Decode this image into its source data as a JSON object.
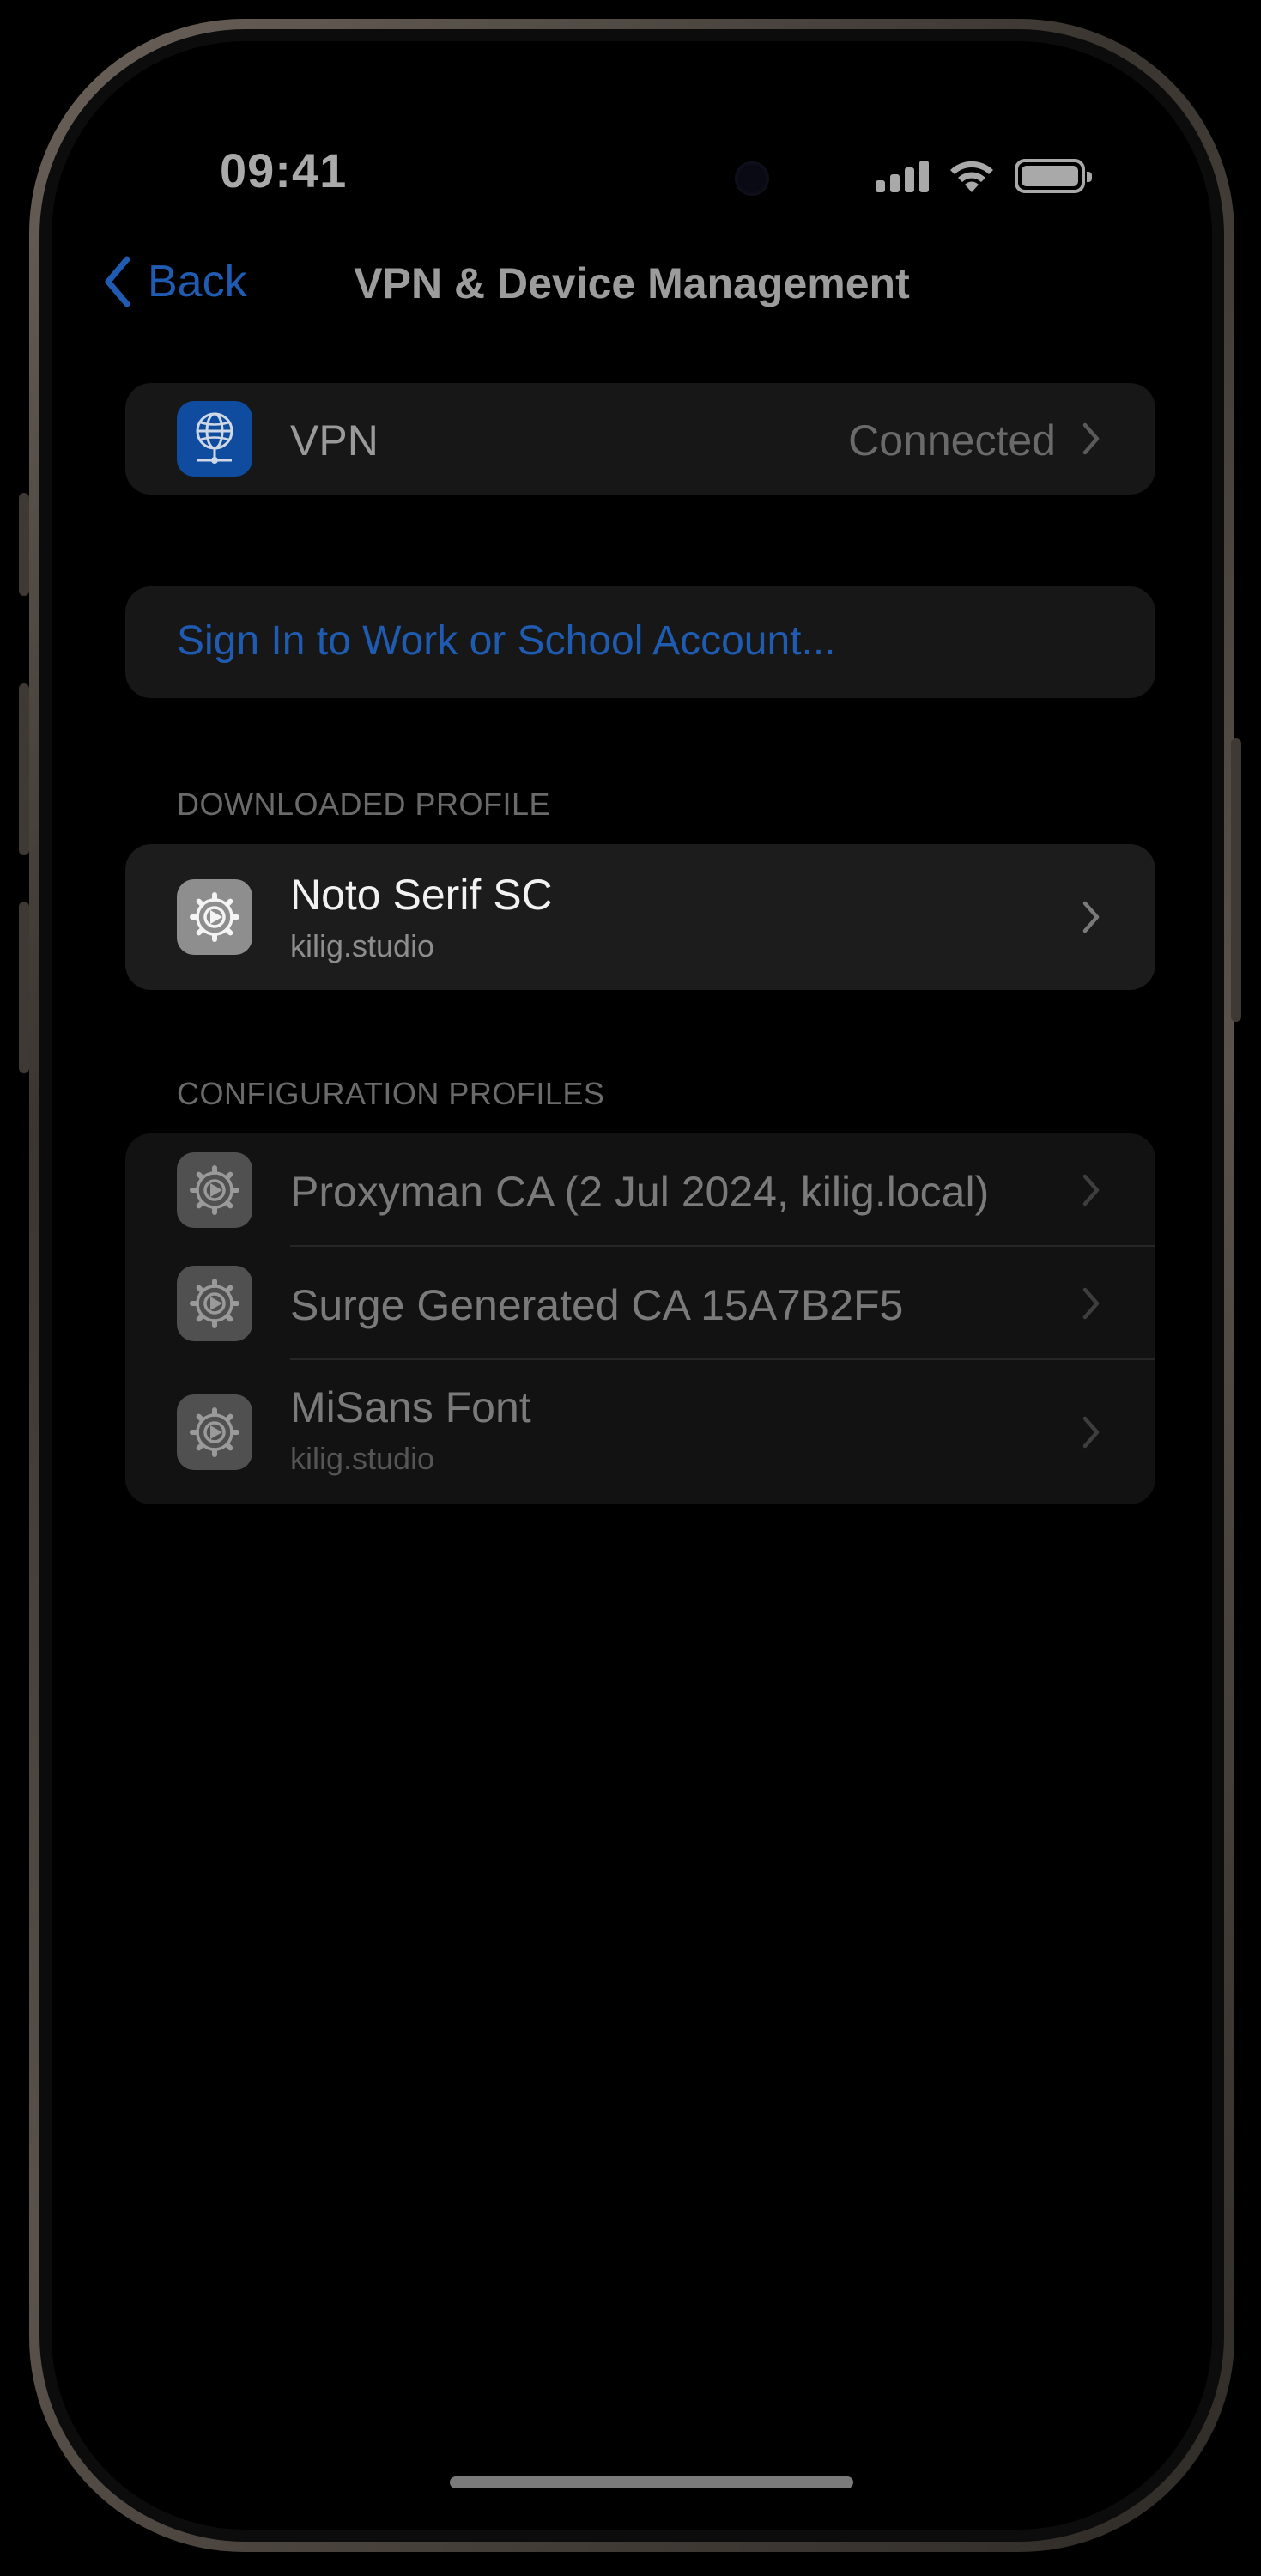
{
  "status_bar": {
    "time": "09:41",
    "icons": [
      "cellular-signal-icon",
      "wifi-icon",
      "battery-icon"
    ]
  },
  "nav": {
    "back_label": "Back",
    "title": "VPN & Device Management"
  },
  "vpn": {
    "label": "VPN",
    "status": "Connected",
    "icon": "vpn-globe-icon"
  },
  "sign_in": {
    "label": "Sign In to Work or School Account..."
  },
  "downloaded_profile": {
    "header": "DOWNLOADED PROFILE",
    "items": [
      {
        "title": "Noto Serif SC",
        "subtitle": "kilig.studio",
        "icon": "settings-gear-icon"
      }
    ]
  },
  "configuration_profiles": {
    "header": "CONFIGURATION PROFILES",
    "items": [
      {
        "title": "Proxyman CA (2 Jul 2024, kilig.local)",
        "icon": "settings-gear-icon"
      },
      {
        "title": "Surge Generated CA 15A7B2F5",
        "icon": "settings-gear-icon"
      },
      {
        "title": "MiSans Font",
        "subtitle": "kilig.studio",
        "icon": "settings-gear-icon"
      }
    ]
  },
  "colors": {
    "accent": "#1f5bb0",
    "background": "#000000",
    "group_background": "#171717",
    "device_frame": "#5a524b"
  }
}
